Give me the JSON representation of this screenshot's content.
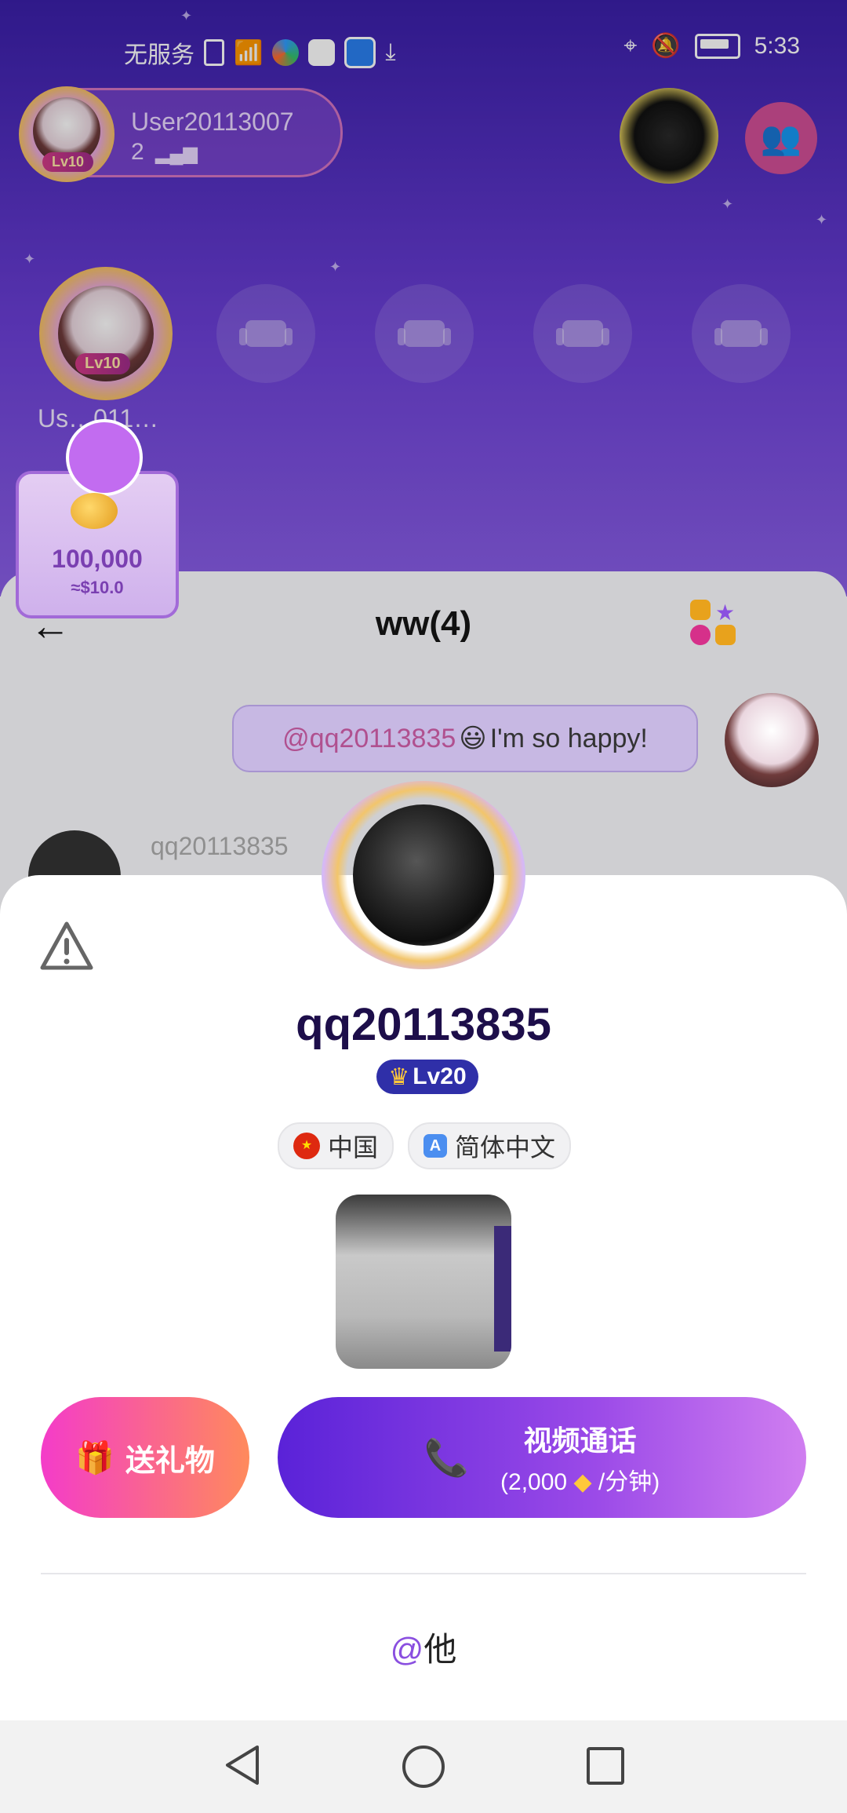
{
  "status_bar": {
    "carrier": "无服务",
    "time": "5:33"
  },
  "room": {
    "owner_name": "User20113007",
    "owner_count": "2",
    "owner_level": "Lv10",
    "host_level": "Lv10",
    "host_name": "Us…011…",
    "gift_amount": "100,000",
    "gift_value": "≈$10.0"
  },
  "chat": {
    "title": "ww(4)",
    "message_mention": "@qq20113835",
    "message_text": " I'm so happy!",
    "sender_name": "qq20113835"
  },
  "profile": {
    "username": "qq20113835",
    "level": "Lv20",
    "country": "中国",
    "language": "简体中文"
  },
  "actions": {
    "gift_label": "送礼物",
    "video_label": "视频通话",
    "video_price_prefix": "(2,000",
    "video_price_suffix": "/分钟)",
    "mention_at": "@",
    "mention_label": "他"
  },
  "colors": {
    "accent_purple": "#5a22d8",
    "gift_pink": "#f43cc9",
    "username_dark": "#1d0e4a",
    "level_blue": "#2f2fa8"
  }
}
